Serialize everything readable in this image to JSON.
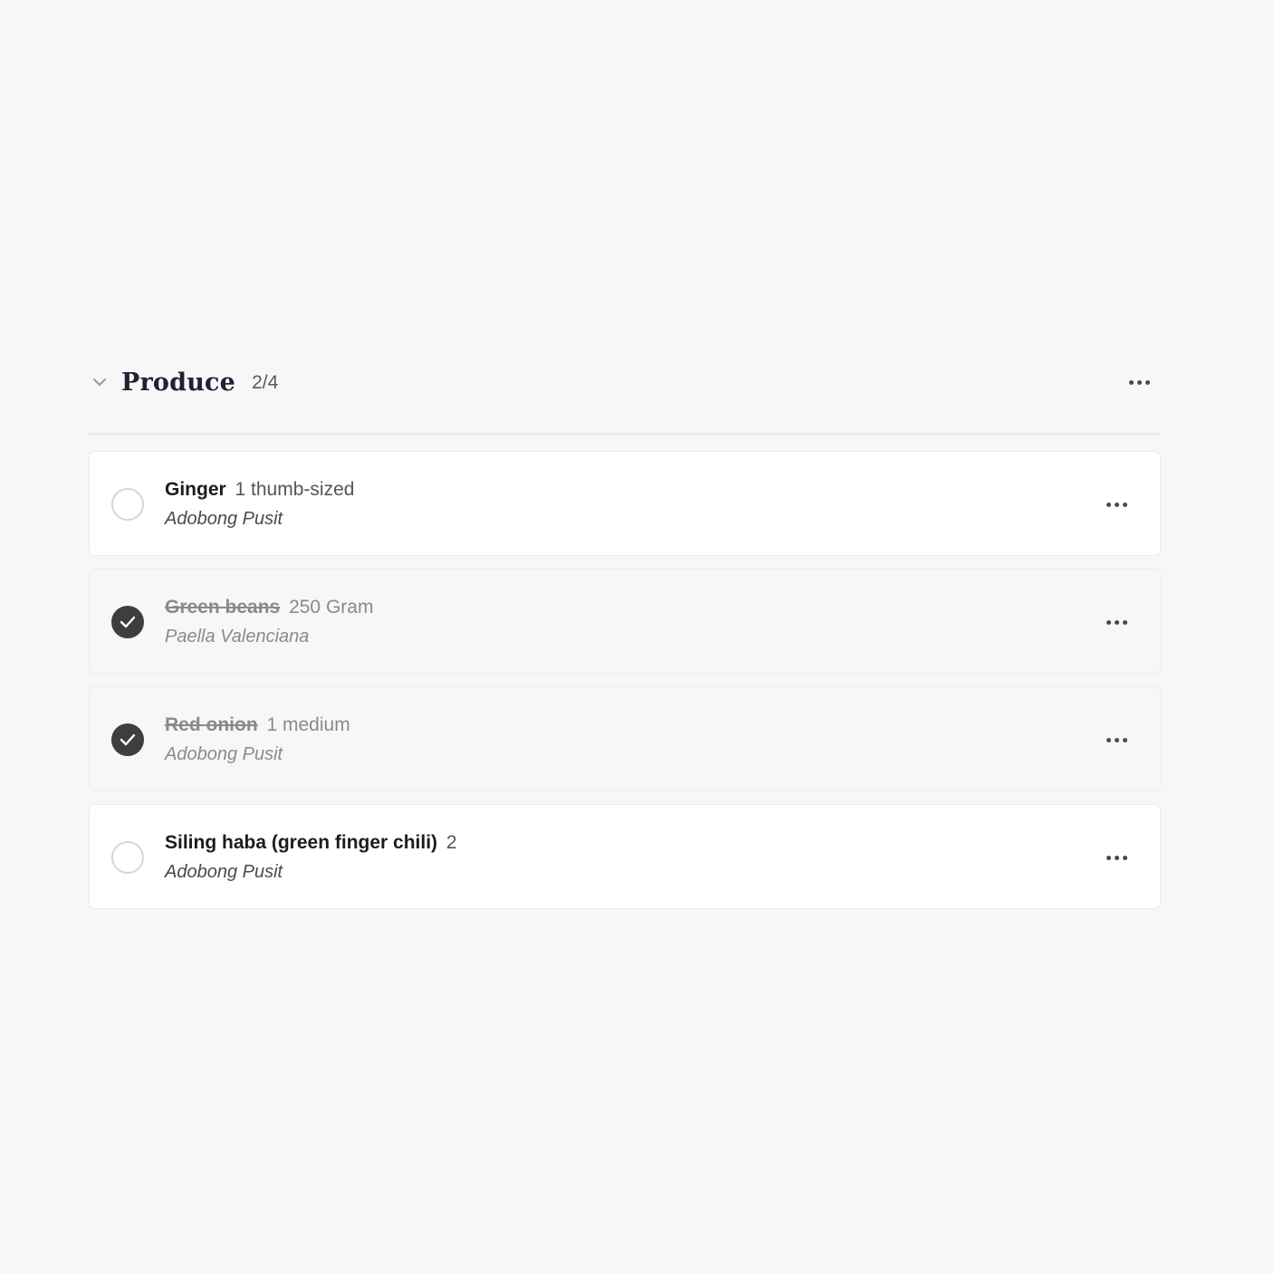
{
  "section": {
    "title": "Produce",
    "count": "2/4",
    "collapse_icon": "chevron-down-icon",
    "more_icon": "more-horizontal-icon"
  },
  "items": [
    {
      "name": "Ginger",
      "quantity": "1 thumb-sized",
      "recipe": "Adobong Pusit",
      "checked": false
    },
    {
      "name": "Green beans",
      "quantity": "250 Gram",
      "recipe": "Paella Valenciana",
      "checked": true
    },
    {
      "name": "Red onion",
      "quantity": "1 medium",
      "recipe": "Adobong Pusit",
      "checked": true
    },
    {
      "name": "Siling haba (green finger chili)",
      "quantity": "2",
      "recipe": "Adobong Pusit",
      "checked": false
    }
  ],
  "colors": {
    "background": "#f8f7f7",
    "card": "#ffffff",
    "checked_fill": "#3e3e3e",
    "title": "#1e2233"
  }
}
